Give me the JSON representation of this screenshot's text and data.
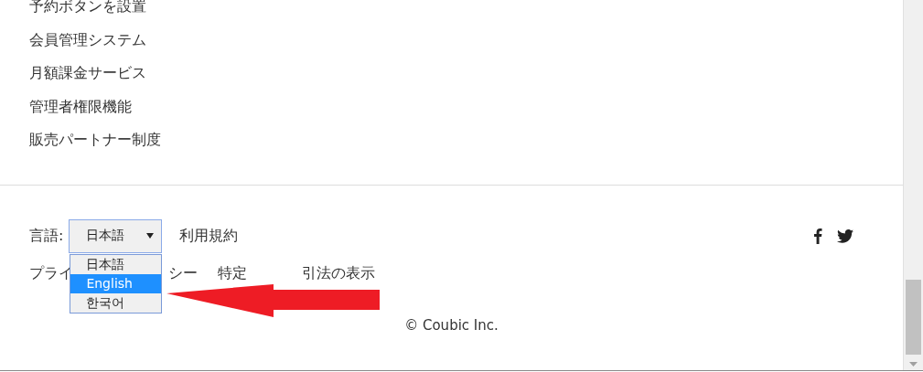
{
  "features": [
    "予約ボタンを設置",
    "会員管理システム",
    "月額課金サービス",
    "管理者権限機能",
    "販売パートナー制度"
  ],
  "footer": {
    "language_label": "言語:",
    "language_select": {
      "value": "日本語",
      "expanded": true,
      "options": [
        {
          "label": "日本語",
          "highlighted": false
        },
        {
          "label": "English",
          "highlighted": true
        },
        {
          "label": "한국어",
          "highlighted": false
        }
      ]
    },
    "terms_link": "利用規約",
    "covered_links": [
      "プライ",
      "シー",
      "特定",
      "引法の表示"
    ],
    "copyright": "© Coubic Inc."
  }
}
